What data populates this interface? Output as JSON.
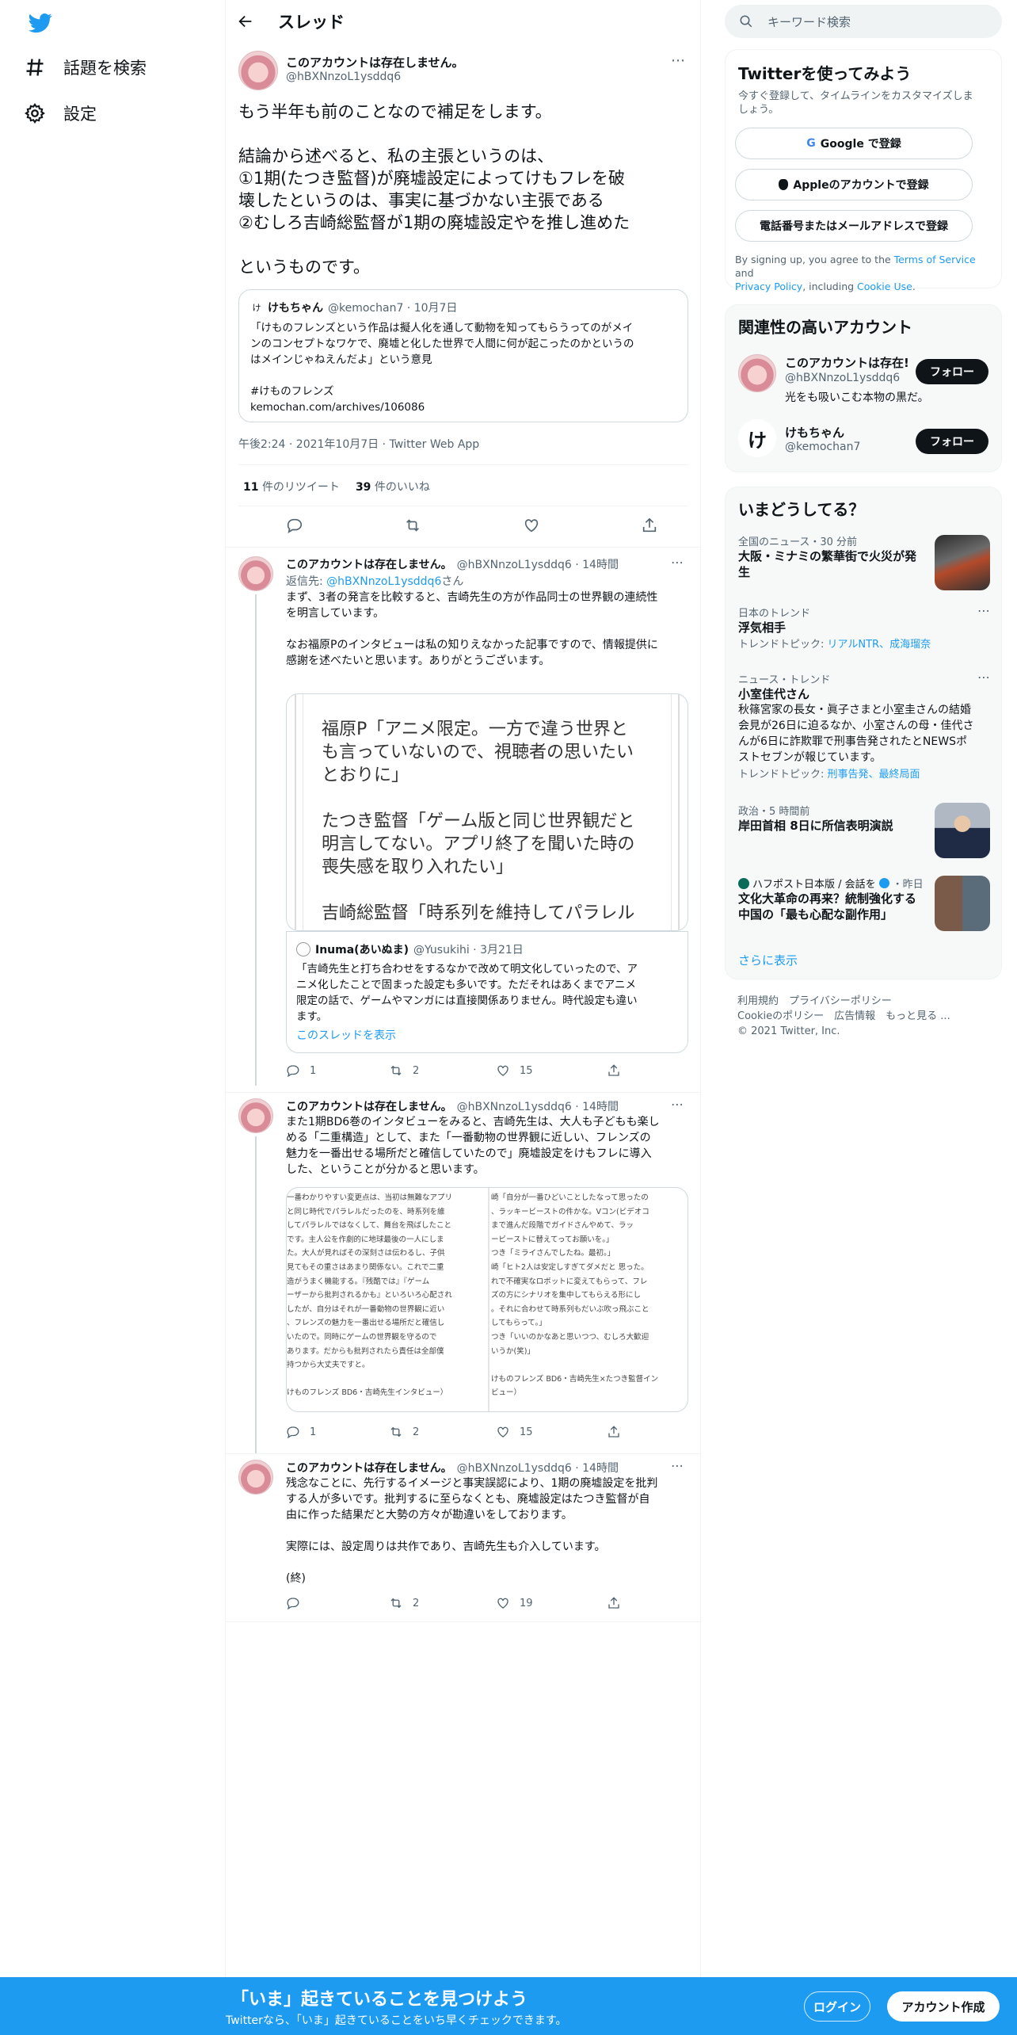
{
  "nav": {
    "explore": "話題を検索",
    "settings": "設定"
  },
  "header": {
    "title": "スレッド"
  },
  "main_tweet": {
    "name": "このアカウントは存在しません。",
    "handle": "@hBXNnzoL1ysddq6",
    "text": [
      "もう半年も前のことなので補足をします。",
      "",
      "結論から述べると、私の主張というのは、",
      "①1期(たつき監督)が廃墟設定によってけもフレを破",
      "壊したというのは、事実に基づかない主張である",
      "②むしろ吉崎総監督が1期の廃墟設定やを推し進めた",
      "",
      "というものです。"
    ],
    "quote": {
      "name": "けもちゃん",
      "meta": "@kemochan7 · 10月7日",
      "text": [
        "「けものフレンズという作品は擬人化を通して動物を知ってもらうってのがメイ",
        "ンのコンセプトなワケで、廃墟と化した世界で人間に何が起こったのかというの",
        "はメインじゃねえんだよ」という意見",
        "",
        "#けものフレンズ",
        "kemochan.com/archives/106086"
      ]
    },
    "timestamp": "午後2:24 · 2021年10月7日 · Twitter Web App",
    "retweets": "11",
    "retweets_label": "件のリツイート",
    "likes": "39",
    "likes_label": "件のいいね"
  },
  "replies": [
    {
      "name": "このアカウントは存在しません。",
      "handle_time": "@hBXNnzoL1ysddq6 · 14時間",
      "replyto_prefix": "返信先: ",
      "replyto": "@hBXNnzoL1ysddq6",
      "replyto_suffix": "さん",
      "text": [
        "まず、3者の発言を比較すると、吉崎先生の方が作品同士の世界観の連続性",
        "を明言しています。",
        "",
        "なお福原Pのインタビューは私の知りえなかった記事ですので、情報提供に",
        "感謝を述べたいと思います。ありがとうございます。"
      ],
      "image_text": [
        "福原P「アニメ限定。一方で違う世界と",
        "も言っていないので、視聴者の思いたい",
        "とおりに」",
        "",
        "たつき監督「ゲーム版と同じ世界観だと",
        "明言してない。アプリ終了を聞いた時の",
        "喪失感を取り入れたい」",
        "",
        "吉崎総監督「時系列を維持してパラレル"
      ],
      "quote": {
        "name": "Inuma(あいぬま)",
        "meta": "@Yusukihi · 3月21日",
        "text": [
          "「吉崎先生と打ち合わせをするなかで改めて明文化していったので、ア",
          "ニメ化したことで固まった設定も多いです。ただそれはあくまでアニメ",
          "限定の話で、ゲームやマンガには直接関係ありません。時代設定も違い",
          "ます。"
        ],
        "show_thread": "このスレッドを表示"
      },
      "replies": "1",
      "retweets": "2",
      "likes": "15"
    },
    {
      "name": "このアカウントは存在しません。",
      "handle_time": "@hBXNnzoL1ysddq6 · 14時間",
      "text": [
        "また1期BD6巻のインタビューをみると、吉崎先生は、大人も子どもも楽し",
        "める「二重構造」として、また「一番動物の世界観に近しい、フレンズの",
        "魅力を一番出せる場所だと確信していたので」廃墟設定をけもフレに導入",
        "した、ということが分かると思います。"
      ],
      "image_left": [
        "一番わかりやすい変更点は、当初は無難なアプリ",
        "と同じ時代でパラレルだったのを、時系列を維",
        "してパラレルではなくして、舞台を飛ばしたこと",
        "です。主人公を作劇的に地球最後の一人にしま",
        "た。大人が見ればその深刻さは伝わるし、子供",
        "見てもその重さはあまり関係ない。これで二重",
        "造がうまく機能する。『残酷では』『ゲーム",
        "ーザーから批判されるかも』といろいろ心配され",
        "したが、自分はそれが一番動物の世界観に近い",
        "、フレンズの魅力を一番出せる場所だと確信し",
        "いたので。同時にゲームの世界観を守るので",
        "あります。だからも批判されたら責任は全部僕",
        "持つから大丈夫ですと。",
        "",
        "けものフレンズ BD6・吉崎先生インタビュー）"
      ],
      "image_right": [
        "崎「自分が一番ひどいことしたなって思ったの",
        "、ラッキービーストの件かな。Vコン(ビデオコ",
        "まで進んだ段階でガイドさんやめて、ラッ",
        "ービーストに替えてってお願いを。」",
        "つき「ミライさんでしたね。最初。」",
        "崎「ヒト2人は安定しすぎてダメだと 思った。",
        "れで不確実なロボットに変えてもらって、フレ",
        "ズの方にシナリオを集中してもらえる形にし",
        "。それに合わせて時系列もだいぶ吹っ飛ぶこと",
        "してもらって。」",
        "つき「いいのかなあと思いつつ、むしろ大歓迎",
        "いうか(笑)」",
        "",
        "けものフレンズ BD6・吉崎先生×たつき監督イン",
        "ビュー）"
      ],
      "replies": "1",
      "retweets": "2",
      "likes": "15"
    },
    {
      "name": "このアカウントは存在しません。",
      "handle_time": "@hBXNnzoL1ysddq6 · 14時間",
      "text": [
        "残念なことに、先行するイメージと事実誤認により、1期の廃墟設定を批判",
        "する人が多いです。批判するに至らなくとも、廃墟設定はたつき監督が自",
        "由に作った結果だと大勢の方々が勘違いをしております。",
        "",
        "実際には、設定周りは共作であり、吉崎先生も介入しています。",
        "",
        "(終)"
      ],
      "replies": "",
      "retweets": "2",
      "likes": "19"
    }
  ],
  "search": {
    "placeholder": "キーワード検索"
  },
  "signup": {
    "title": "Twitterを使ってみよう",
    "subtitle": [
      "今すぐ登録して、タイムラインをカスタマイズしま",
      "しょう。"
    ],
    "google": "Google で登録",
    "apple": "Appleのアカウントで登録",
    "phone": "電話番号またはメールアドレスで登録",
    "legal_a": "By signing up, you agree to the ",
    "tos": "Terms of Service",
    "legal_b": " and",
    "privacy": "Privacy Policy",
    "legal_c": ", including ",
    "cookie": "Cookie Use",
    "legal_d": "."
  },
  "related": {
    "title": "関連性の高いアカウント",
    "accounts": [
      {
        "name": "このアカウントは存在!",
        "handle": "@hBXNnzoL1ysddq6",
        "bio": "光をも吸いこむ本物の黒だ。",
        "follow": "フォロー"
      },
      {
        "name": "けもちゃん",
        "handle": "@kemochan7",
        "avatar_text": "け",
        "follow": "フォロー"
      }
    ]
  },
  "trends": {
    "title": "いまどうしてる？",
    "items": [
      {
        "meta": "全国のニュース・30 分前",
        "title": [
          "大阪・ミナミの繁華街で火災が発",
          "生"
        ]
      },
      {
        "meta": "日本のトレンド",
        "title": [
          "浮気相手"
        ],
        "topic_prefix": "トレンドトピック: ",
        "topic": "リアルNTR、成海瑠奈"
      },
      {
        "meta": "ニュース・トレンド",
        "title": [
          "小室佳代さん"
        ],
        "desc": [
          "秋篠宮家の長女・眞子さまと小室圭さんの結婚",
          "会見が26日に迫るなか、小室さんの母・佳代さ",
          "んが6日に詐欺罪で刑事告発されたとNEWSポ",
          "ストセブンが報じています。"
        ],
        "topic_prefix": "トレンドトピック: ",
        "topic": "刑事告発、最終局面"
      },
      {
        "meta": "政治・5 時間前",
        "title": [
          "岸田首相 8日に所信表明演説"
        ]
      },
      {
        "meta_source": "ハフポスト日本版 / 会話を",
        "meta_time": "・昨日",
        "title": [
          "文化大革命の再来？統制強化する",
          "中国の「最も心配な副作用」"
        ]
      }
    ],
    "more": "さらに表示"
  },
  "footer": {
    "terms": "利用規約",
    "privacy": "プライバシーポリシー",
    "cookie": "Cookieのポリシー",
    "ads": "広告情報",
    "more": "もっと見る ...",
    "copyright": "© 2021 Twitter, Inc."
  },
  "banner": {
    "title": "「いま」起きていることを見つけよう",
    "subtitle": "Twitterなら、「いま」起きていることをいち早くチェックできます。",
    "login": "ログイン",
    "signup": "アカウント作成"
  },
  "colors": {
    "accent": "#1d9bf0",
    "text": "#0f1419",
    "muted": "#536471"
  }
}
